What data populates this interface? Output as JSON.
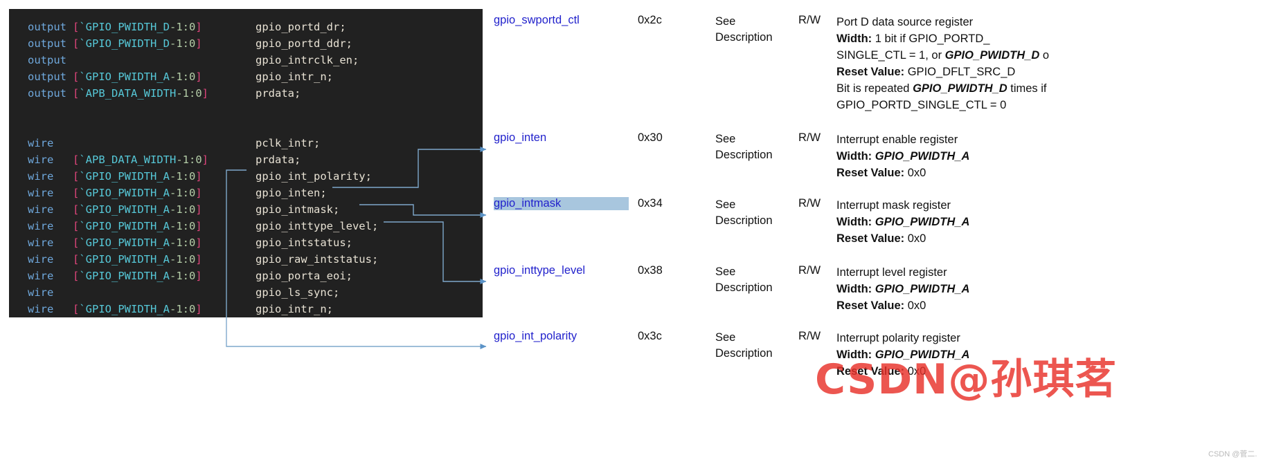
{
  "code_block": {
    "language": "verilog",
    "background": "#212121",
    "lines": [
      {
        "kw": "output",
        "range": [
          {
            "t": "[",
            "c": "bracket"
          },
          {
            "t": "`GPIO_PWIDTH_D",
            "c": "macro"
          },
          {
            "t": "-1:0",
            "c": "num"
          },
          {
            "t": "]",
            "c": "bracket"
          }
        ],
        "signal": "gpio_portd_dr;"
      },
      {
        "kw": "output",
        "range": [
          {
            "t": "[",
            "c": "bracket"
          },
          {
            "t": "`GPIO_PWIDTH_D",
            "c": "macro"
          },
          {
            "t": "-1:0",
            "c": "num"
          },
          {
            "t": "]",
            "c": "bracket"
          }
        ],
        "signal": "gpio_portd_ddr;"
      },
      {
        "kw": "output",
        "range": [],
        "signal": "gpio_intrclk_en;"
      },
      {
        "kw": "output",
        "range": [
          {
            "t": "[",
            "c": "bracket"
          },
          {
            "t": "`GPIO_PWIDTH_A",
            "c": "macro"
          },
          {
            "t": "-1:0",
            "c": "num"
          },
          {
            "t": "]",
            "c": "bracket"
          }
        ],
        "signal": "gpio_intr_n;"
      },
      {
        "kw": "output",
        "range": [
          {
            "t": "[",
            "c": "bracket"
          },
          {
            "t": "`APB_DATA_WIDTH",
            "c": "macro"
          },
          {
            "t": "-1:0",
            "c": "num"
          },
          {
            "t": "]",
            "c": "bracket"
          }
        ],
        "signal": "prdata;"
      },
      {
        "kw": "",
        "range": [],
        "signal": ""
      },
      {
        "kw": "",
        "range": [],
        "signal": ""
      },
      {
        "kw": "wire",
        "range": [],
        "signal": "pclk_intr;"
      },
      {
        "kw": "wire",
        "range": [
          {
            "t": "[",
            "c": "bracket"
          },
          {
            "t": "`APB_DATA_WIDTH",
            "c": "macro"
          },
          {
            "t": "-1:0",
            "c": "num"
          },
          {
            "t": "]",
            "c": "bracket"
          }
        ],
        "signal": "prdata;"
      },
      {
        "kw": "wire",
        "range": [
          {
            "t": "[",
            "c": "bracket"
          },
          {
            "t": "`GPIO_PWIDTH_A",
            "c": "macro"
          },
          {
            "t": "-1:0",
            "c": "num"
          },
          {
            "t": "]",
            "c": "bracket"
          }
        ],
        "signal": "gpio_int_polarity;"
      },
      {
        "kw": "wire",
        "range": [
          {
            "t": "[",
            "c": "bracket"
          },
          {
            "t": "`GPIO_PWIDTH_A",
            "c": "macro"
          },
          {
            "t": "-1:0",
            "c": "num"
          },
          {
            "t": "]",
            "c": "bracket"
          }
        ],
        "signal": "gpio_inten;"
      },
      {
        "kw": "wire",
        "range": [
          {
            "t": "[",
            "c": "bracket"
          },
          {
            "t": "`GPIO_PWIDTH_A",
            "c": "macro"
          },
          {
            "t": "-1:0",
            "c": "num"
          },
          {
            "t": "]",
            "c": "bracket"
          }
        ],
        "signal": "gpio_intmask;"
      },
      {
        "kw": "wire",
        "range": [
          {
            "t": "[",
            "c": "bracket"
          },
          {
            "t": "`GPIO_PWIDTH_A",
            "c": "macro"
          },
          {
            "t": "-1:0",
            "c": "num"
          },
          {
            "t": "]",
            "c": "bracket"
          }
        ],
        "signal": "gpio_inttype_level;"
      },
      {
        "kw": "wire",
        "range": [
          {
            "t": "[",
            "c": "bracket"
          },
          {
            "t": "`GPIO_PWIDTH_A",
            "c": "macro"
          },
          {
            "t": "-1:0",
            "c": "num"
          },
          {
            "t": "]",
            "c": "bracket"
          }
        ],
        "signal": "gpio_intstatus;"
      },
      {
        "kw": "wire",
        "range": [
          {
            "t": "[",
            "c": "bracket"
          },
          {
            "t": "`GPIO_PWIDTH_A",
            "c": "macro"
          },
          {
            "t": "-1:0",
            "c": "num"
          },
          {
            "t": "]",
            "c": "bracket"
          }
        ],
        "signal": "gpio_raw_intstatus;"
      },
      {
        "kw": "wire",
        "range": [
          {
            "t": "[",
            "c": "bracket"
          },
          {
            "t": "`GPIO_PWIDTH_A",
            "c": "macro"
          },
          {
            "t": "-1:0",
            "c": "num"
          },
          {
            "t": "]",
            "c": "bracket"
          }
        ],
        "signal": "gpio_porta_eoi;"
      },
      {
        "kw": "wire",
        "range": [],
        "signal": "gpio_ls_sync;"
      },
      {
        "kw": "wire",
        "range": [
          {
            "t": "[",
            "c": "bracket"
          },
          {
            "t": "`GPIO_PWIDTH_A",
            "c": "macro"
          },
          {
            "t": "-1:0",
            "c": "num"
          },
          {
            "t": "]",
            "c": "bracket"
          }
        ],
        "signal": "gpio_intr_n;"
      }
    ]
  },
  "register_table": {
    "rows": [
      {
        "name": "gpio_swportd_ctl",
        "highlighted": false,
        "offset": "0x2c",
        "size": "See Description",
        "access": "R/W",
        "desc_lines": [
          {
            "segments": [
              {
                "t": "Port D data source register",
                "s": "normal"
              }
            ]
          },
          {
            "segments": [
              {
                "t": "Width:",
                "s": "bold"
              },
              {
                "t": " 1 bit if GPIO_PORTD_",
                "s": "normal"
              }
            ]
          },
          {
            "segments": [
              {
                "t": "SINGLE_CTL = 1, or ",
                "s": "normal"
              },
              {
                "t": "GPIO_PWIDTH_D",
                "s": "italic"
              },
              {
                "t": " o",
                "s": "normal"
              }
            ]
          },
          {
            "segments": [
              {
                "t": "Reset Value:",
                "s": "bold"
              },
              {
                "t": " GPIO_DFLT_SRC_D",
                "s": "normal"
              }
            ]
          },
          {
            "segments": [
              {
                "t": "Bit is repeated ",
                "s": "normal"
              },
              {
                "t": "GPIO_PWIDTH_D",
                "s": "italic"
              },
              {
                "t": " times if",
                "s": "normal"
              }
            ]
          },
          {
            "segments": [
              {
                "t": "GPIO_PORTD_SINGLE_CTL = 0",
                "s": "normal"
              }
            ]
          }
        ]
      },
      {
        "name": "gpio_inten",
        "highlighted": false,
        "offset": "0x30",
        "size": "See Description",
        "access": "R/W",
        "desc_lines": [
          {
            "segments": [
              {
                "t": "Interrupt enable register",
                "s": "normal"
              }
            ]
          },
          {
            "segments": [
              {
                "t": "Width:",
                "s": "bold"
              },
              {
                "t": " ",
                "s": "normal"
              },
              {
                "t": "GPIO_PWIDTH_A",
                "s": "italic"
              }
            ]
          },
          {
            "segments": [
              {
                "t": "Reset Value:",
                "s": "bold"
              },
              {
                "t": " 0x0",
                "s": "normal"
              }
            ]
          }
        ]
      },
      {
        "name": "gpio_intmask",
        "highlighted": true,
        "offset": "0x34",
        "size": "See Description",
        "access": "R/W",
        "desc_lines": [
          {
            "segments": [
              {
                "t": "Interrupt mask register",
                "s": "normal"
              }
            ]
          },
          {
            "segments": [
              {
                "t": "Width:",
                "s": "bold"
              },
              {
                "t": " ",
                "s": "normal"
              },
              {
                "t": "GPIO_PWIDTH_A",
                "s": "italic"
              }
            ]
          },
          {
            "segments": [
              {
                "t": "Reset Value:",
                "s": "bold"
              },
              {
                "t": " 0x0",
                "s": "normal"
              }
            ]
          }
        ]
      },
      {
        "name": "gpio_inttype_level",
        "highlighted": false,
        "offset": "0x38",
        "size": "See Description",
        "access": "R/W",
        "desc_lines": [
          {
            "segments": [
              {
                "t": "Interrupt level register",
                "s": "normal"
              }
            ]
          },
          {
            "segments": [
              {
                "t": "Width:",
                "s": "bold"
              },
              {
                "t": " ",
                "s": "normal"
              },
              {
                "t": "GPIO_PWIDTH_A",
                "s": "italic"
              }
            ]
          },
          {
            "segments": [
              {
                "t": "Reset Value:",
                "s": "bold"
              },
              {
                "t": " 0x0",
                "s": "normal"
              }
            ]
          }
        ]
      },
      {
        "name": "gpio_int_polarity",
        "highlighted": false,
        "offset": "0x3c",
        "size": "See Description",
        "access": "R/W",
        "desc_lines": [
          {
            "segments": [
              {
                "t": "Interrupt polarity register",
                "s": "normal"
              }
            ]
          },
          {
            "segments": [
              {
                "t": "Width:",
                "s": "bold"
              },
              {
                "t": " ",
                "s": "normal"
              },
              {
                "t": "GPIO_PWIDTH_A",
                "s": "italic"
              }
            ]
          },
          {
            "segments": [
              {
                "t": "Reset Value:",
                "s": "bold"
              },
              {
                "t": " 0x0",
                "s": "normal"
              }
            ]
          }
        ]
      }
    ]
  },
  "connectors": {
    "color": "#7fa8cc",
    "arrow_color": "#5b93c7",
    "links": [
      {
        "from_signal": "gpio_inten",
        "to_register": "gpio_inten"
      },
      {
        "from_signal": "gpio_intmask",
        "to_register": "gpio_intmask"
      },
      {
        "from_signal": "gpio_inttype_level",
        "to_register": "gpio_inttype_level"
      },
      {
        "from_signal": "gpio_int_polarity",
        "to_register": "gpio_int_polarity"
      }
    ]
  },
  "watermarks": {
    "main": "CSDN@孙琪茗",
    "main_color": "#e8312a",
    "small": "CSDN @菅二."
  }
}
